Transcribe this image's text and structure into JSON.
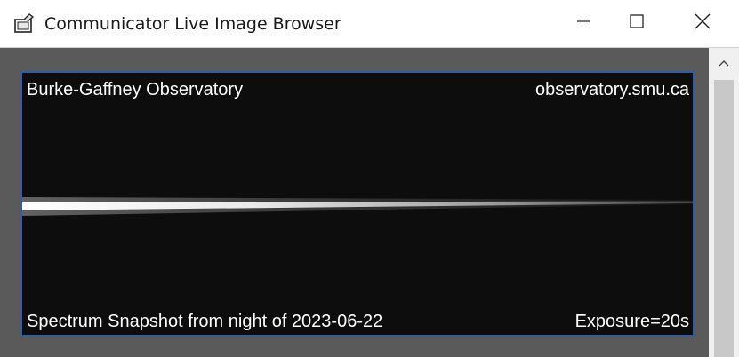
{
  "window": {
    "title": "Communicator Live Image Browser",
    "icon": "communicator-app-icon",
    "controls": [
      "minimize-icon",
      "maximize-icon",
      "close-icon"
    ]
  },
  "image": {
    "top_left_text": "Burke-Gaffney Observatory",
    "top_right_text": "observatory.smu.ca",
    "bottom_left_text": "Spectrum Snapshot from night of 2023-06-22",
    "bottom_right_text": "Exposure=20s",
    "frame_color": "#2c5fa8",
    "background_color": "#0d0d0d"
  },
  "scrollbar": {
    "up_icon": "chevron-up-icon"
  }
}
